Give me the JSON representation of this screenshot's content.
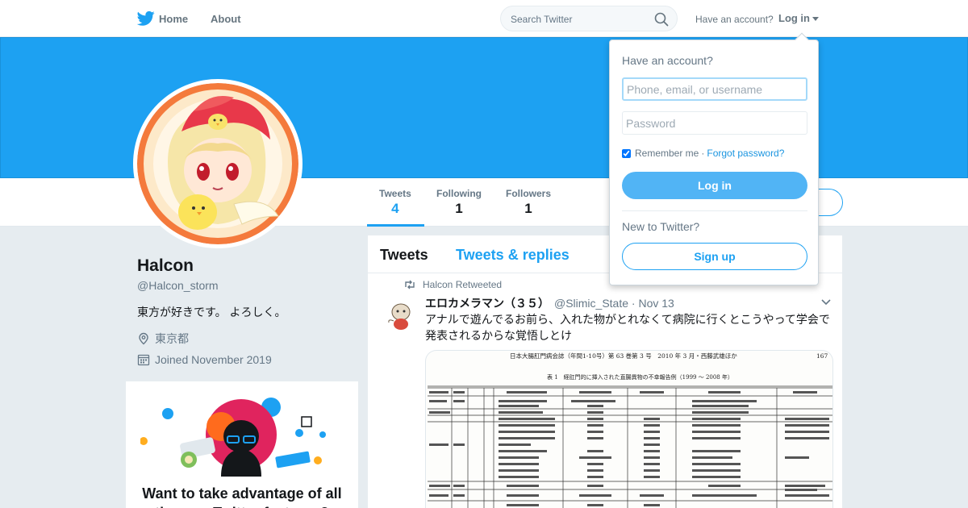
{
  "nav": {
    "home_label": "Home",
    "about_label": "About",
    "search_placeholder": "Search Twitter",
    "have_account": "Have an account?",
    "login_label": "Log in"
  },
  "profile_nav": {
    "stats": [
      {
        "label": "Tweets",
        "value": "4"
      },
      {
        "label": "Following",
        "value": "1"
      },
      {
        "label": "Followers",
        "value": "1"
      }
    ]
  },
  "profile": {
    "name": "Halcon",
    "handle": "@Halcon_storm",
    "bio": "東方が好きです。 よろしく。",
    "location": "東京都",
    "joined": "Joined November 2019"
  },
  "promo": {
    "title": "Want to take advantage of all the new Twitter features?"
  },
  "timeline": {
    "tabs": [
      "Tweets",
      "Tweets & replies"
    ],
    "tweet": {
      "retweeted_by": "Halcon Retweeted",
      "author_name": "エロカメラマン（３５）",
      "author_handle": "@Slimic_State",
      "date": "· Nov 13",
      "text": "アナルで遊んでるお前ら、入れた物がとれなくて病院に行くとこうやって学会で発表されるからな覚悟しとけ",
      "media": {
        "header": "日本大腸肛門病会誌（年間1-10号）第 63 巻第 3 号　2010 年 3 月・西藤武雄ほか",
        "page": "167",
        "table_title": "表 1　経肛門的に挿入された直腸異物の不幸報告例（1999 ～ 2008 年）"
      }
    }
  },
  "login_dropdown": {
    "title": "Have an account?",
    "username_placeholder": "Phone, email, or username",
    "password_placeholder": "Password",
    "remember_label": "Remember me",
    "forgot_label": "Forgot password?",
    "login_button": "Log in",
    "new_label": "New to Twitter?",
    "signup_button": "Sign up"
  },
  "colors": {
    "brand": "#1da1f2",
    "background": "#e6ecf0"
  }
}
